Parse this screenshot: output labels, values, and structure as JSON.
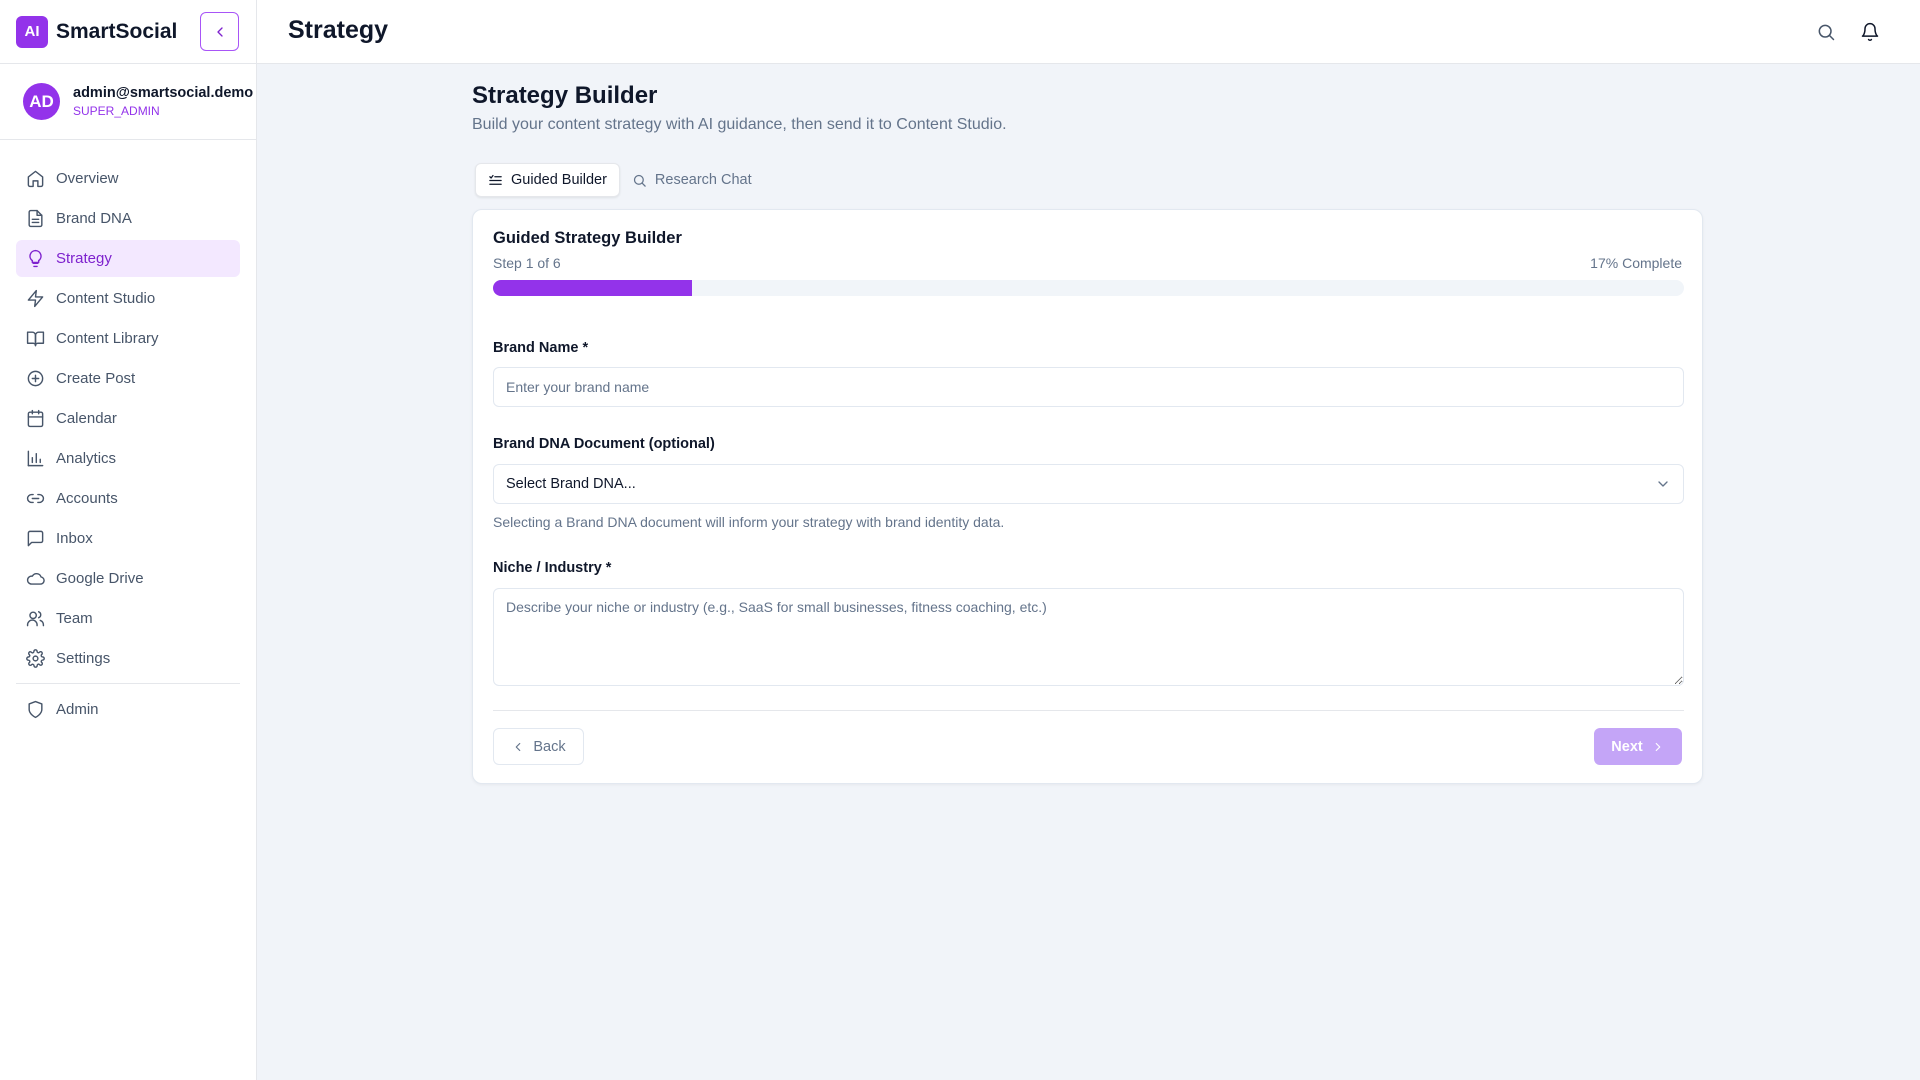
{
  "app": {
    "logo": "AI",
    "name": "SmartSocial"
  },
  "user": {
    "initials": "AD",
    "email": "admin@smartsocial.demo",
    "role": "SUPER_ADMIN"
  },
  "sidebar": {
    "items": [
      {
        "label": "Overview",
        "icon": "home-icon"
      },
      {
        "label": "Brand DNA",
        "icon": "document-icon"
      },
      {
        "label": "Strategy",
        "icon": "lightbulb-icon",
        "active": true
      },
      {
        "label": "Content Studio",
        "icon": "bolt-icon"
      },
      {
        "label": "Content Library",
        "icon": "book-icon"
      },
      {
        "label": "Create Post",
        "icon": "plus-circle-icon"
      },
      {
        "label": "Calendar",
        "icon": "calendar-icon"
      },
      {
        "label": "Analytics",
        "icon": "bar-chart-icon"
      },
      {
        "label": "Accounts",
        "icon": "link-icon"
      },
      {
        "label": "Inbox",
        "icon": "message-icon"
      },
      {
        "label": "Google Drive",
        "icon": "cloud-icon"
      },
      {
        "label": "Team",
        "icon": "users-icon"
      },
      {
        "label": "Settings",
        "icon": "gear-icon"
      }
    ],
    "admin": {
      "label": "Admin",
      "icon": "shield-icon"
    }
  },
  "header": {
    "title": "Strategy"
  },
  "main": {
    "title": "Strategy Builder",
    "subtitle": "Build your content strategy with AI guidance, then send it to Content Studio.",
    "tabs": [
      {
        "label": "Guided Builder",
        "icon": "list-check-icon",
        "active": true
      },
      {
        "label": "Research Chat",
        "icon": "search-icon"
      }
    ]
  },
  "builder": {
    "title": "Guided Strategy Builder",
    "step_text": "Step 1 of 6",
    "percent_text": "17% Complete",
    "progress": 0.1667,
    "brand_name_label": "Brand Name *",
    "brand_name_placeholder": "Enter your brand name",
    "brand_dna_label": "Brand DNA Document (optional)",
    "brand_dna_selected": "Select Brand DNA...",
    "brand_dna_help": "Selecting a Brand DNA document will inform your strategy with brand identity data.",
    "niche_label": "Niche / Industry *",
    "niche_placeholder": "Describe your niche or industry (e.g., SaaS for small businesses, fitness coaching, etc.)",
    "back_label": "Back",
    "next_label": "Next"
  },
  "colors": {
    "accent": "#9333ea",
    "accent_light": "#f3e8ff",
    "next_disabled": "#c4a5f7"
  }
}
